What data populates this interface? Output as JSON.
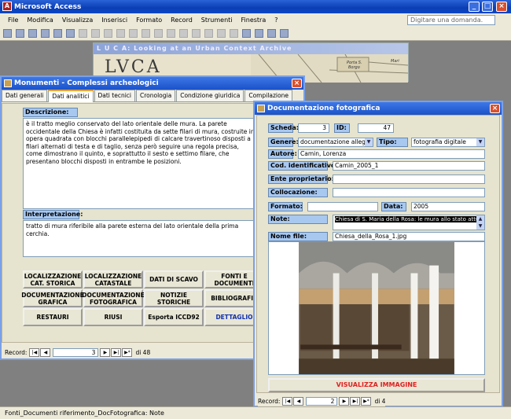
{
  "app": {
    "title": "Microsoft Access"
  },
  "menu": [
    "File",
    "Modifica",
    "Visualizza",
    "Inserisci",
    "Formato",
    "Record",
    "Strumenti",
    "Finestra",
    "?"
  ],
  "help_placeholder": "Digitare una domanda.",
  "luca": {
    "title": "L U C A: Looking at an Urban Context Archive",
    "logo": "LVCA",
    "map_text": [
      "Porta S.",
      "Borgo",
      "Mari"
    ]
  },
  "monumenti": {
    "title": "Monumenti - Complessi archeologici",
    "tabs": [
      "Dati generali",
      "Dati analitici",
      "Dati tecnici",
      "Cronologia",
      "Condizione giuridica",
      "Compilazione"
    ],
    "descrizione_label": "Descrizione:",
    "descrizione": "è il tratto meglio conservato del lato orientale delle mura. La parete occidentale della Chiesa è infatti costituita da sette filari di mura, costruite in opera quadrata con blocchi parallelepipedi di calcare travertinoso disposti a filari alternati di testa e di taglio, senza però seguire una regola precisa, come dimostrano il quinto, e soprattutto il sesto e settimo filare, che presentano blocchi disposti in entrambe le posizioni.",
    "interpretazione_label": "Interpretazione:",
    "interpretazione": "tratto di mura riferibile alla parete esterna del lato orientale della prima cerchia.",
    "buttons": [
      [
        "LOCALIZZAZIONE CAT. STORICA",
        "LOCALIZZAZIONE CATASTALE",
        "DATI DI SCAVO",
        "FONTI E DOCUMENTI"
      ],
      [
        "DOCUMENTAZIONE GRAFICA",
        "DOCUMENTAZIONE FOTOGRAFICA",
        "NOTIZIE STORICHE",
        "BIBLIOGRAFIA"
      ],
      [
        "RESTAURI",
        "RIUSI",
        "Esporta ICCD92",
        "DETTAGLIO"
      ]
    ],
    "nav": {
      "label": "Record:",
      "value": "3",
      "total": "di 48"
    }
  },
  "doc": {
    "title": "Documentazione fotografica",
    "scheda_label": "Scheda:",
    "scheda": "3",
    "id_label": "ID:",
    "id": "47",
    "genere_label": "Genere:",
    "genere": "documentazione allegata",
    "tipo_label": "Tipo:",
    "tipo": "fotografia digitale",
    "autore_label": "Autore:",
    "autore": "Camin, Lorenza",
    "cod_label": "Cod. identificativo:",
    "cod": "Camin_2005_1",
    "ente_label": "Ente proprietario:",
    "ente": "",
    "coll_label": "Collocazione:",
    "coll": "",
    "formato_label": "Formato:",
    "formato": "",
    "data_label": "Data:",
    "data": "2005",
    "note_label": "Note:",
    "note": "Chiesa di S. Maria della Rosa: le mura allo stato attuale.",
    "nome_label": "Nome file:",
    "nome": "Chiesa_della_Rosa_1.jpg",
    "view_button": "VISUALIZZA IMMAGINE",
    "nav": {
      "label": "Record:",
      "value": "2",
      "total": "di 4"
    }
  },
  "status": "Fonti_Documenti riferimento_DocFotografica: Note"
}
